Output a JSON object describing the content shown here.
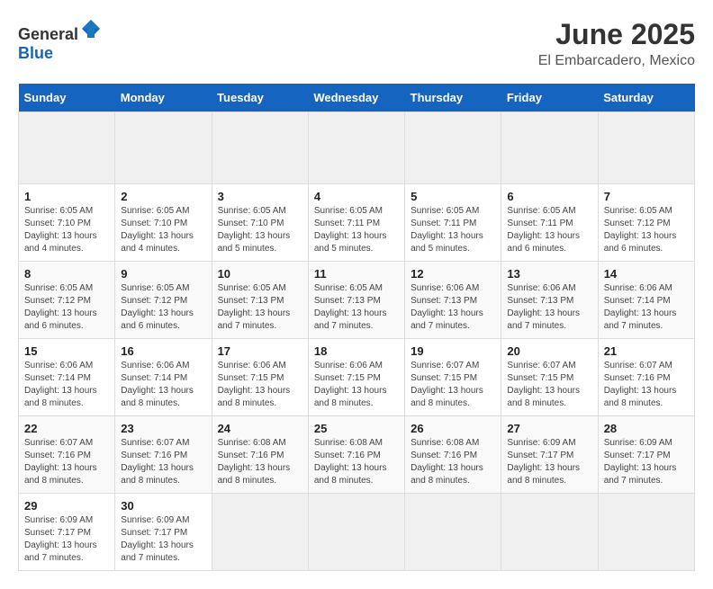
{
  "header": {
    "logo_general": "General",
    "logo_blue": "Blue",
    "title": "June 2025",
    "subtitle": "El Embarcadero, Mexico"
  },
  "calendar": {
    "days_of_week": [
      "Sunday",
      "Monday",
      "Tuesday",
      "Wednesday",
      "Thursday",
      "Friday",
      "Saturday"
    ],
    "weeks": [
      [
        {
          "day": "",
          "empty": true
        },
        {
          "day": "",
          "empty": true
        },
        {
          "day": "",
          "empty": true
        },
        {
          "day": "",
          "empty": true
        },
        {
          "day": "",
          "empty": true
        },
        {
          "day": "",
          "empty": true
        },
        {
          "day": "",
          "empty": true
        }
      ],
      [
        {
          "day": "1",
          "sunrise": "6:05 AM",
          "sunset": "7:10 PM",
          "daylight": "13 hours and 4 minutes."
        },
        {
          "day": "2",
          "sunrise": "6:05 AM",
          "sunset": "7:10 PM",
          "daylight": "13 hours and 4 minutes."
        },
        {
          "day": "3",
          "sunrise": "6:05 AM",
          "sunset": "7:10 PM",
          "daylight": "13 hours and 5 minutes."
        },
        {
          "day": "4",
          "sunrise": "6:05 AM",
          "sunset": "7:11 PM",
          "daylight": "13 hours and 5 minutes."
        },
        {
          "day": "5",
          "sunrise": "6:05 AM",
          "sunset": "7:11 PM",
          "daylight": "13 hours and 5 minutes."
        },
        {
          "day": "6",
          "sunrise": "6:05 AM",
          "sunset": "7:11 PM",
          "daylight": "13 hours and 6 minutes."
        },
        {
          "day": "7",
          "sunrise": "6:05 AM",
          "sunset": "7:12 PM",
          "daylight": "13 hours and 6 minutes."
        }
      ],
      [
        {
          "day": "8",
          "sunrise": "6:05 AM",
          "sunset": "7:12 PM",
          "daylight": "13 hours and 6 minutes."
        },
        {
          "day": "9",
          "sunrise": "6:05 AM",
          "sunset": "7:12 PM",
          "daylight": "13 hours and 6 minutes."
        },
        {
          "day": "10",
          "sunrise": "6:05 AM",
          "sunset": "7:13 PM",
          "daylight": "13 hours and 7 minutes."
        },
        {
          "day": "11",
          "sunrise": "6:05 AM",
          "sunset": "7:13 PM",
          "daylight": "13 hours and 7 minutes."
        },
        {
          "day": "12",
          "sunrise": "6:06 AM",
          "sunset": "7:13 PM",
          "daylight": "13 hours and 7 minutes."
        },
        {
          "day": "13",
          "sunrise": "6:06 AM",
          "sunset": "7:13 PM",
          "daylight": "13 hours and 7 minutes."
        },
        {
          "day": "14",
          "sunrise": "6:06 AM",
          "sunset": "7:14 PM",
          "daylight": "13 hours and 7 minutes."
        }
      ],
      [
        {
          "day": "15",
          "sunrise": "6:06 AM",
          "sunset": "7:14 PM",
          "daylight": "13 hours and 8 minutes."
        },
        {
          "day": "16",
          "sunrise": "6:06 AM",
          "sunset": "7:14 PM",
          "daylight": "13 hours and 8 minutes."
        },
        {
          "day": "17",
          "sunrise": "6:06 AM",
          "sunset": "7:15 PM",
          "daylight": "13 hours and 8 minutes."
        },
        {
          "day": "18",
          "sunrise": "6:06 AM",
          "sunset": "7:15 PM",
          "daylight": "13 hours and 8 minutes."
        },
        {
          "day": "19",
          "sunrise": "6:07 AM",
          "sunset": "7:15 PM",
          "daylight": "13 hours and 8 minutes."
        },
        {
          "day": "20",
          "sunrise": "6:07 AM",
          "sunset": "7:15 PM",
          "daylight": "13 hours and 8 minutes."
        },
        {
          "day": "21",
          "sunrise": "6:07 AM",
          "sunset": "7:16 PM",
          "daylight": "13 hours and 8 minutes."
        }
      ],
      [
        {
          "day": "22",
          "sunrise": "6:07 AM",
          "sunset": "7:16 PM",
          "daylight": "13 hours and 8 minutes."
        },
        {
          "day": "23",
          "sunrise": "6:07 AM",
          "sunset": "7:16 PM",
          "daylight": "13 hours and 8 minutes."
        },
        {
          "day": "24",
          "sunrise": "6:08 AM",
          "sunset": "7:16 PM",
          "daylight": "13 hours and 8 minutes."
        },
        {
          "day": "25",
          "sunrise": "6:08 AM",
          "sunset": "7:16 PM",
          "daylight": "13 hours and 8 minutes."
        },
        {
          "day": "26",
          "sunrise": "6:08 AM",
          "sunset": "7:16 PM",
          "daylight": "13 hours and 8 minutes."
        },
        {
          "day": "27",
          "sunrise": "6:09 AM",
          "sunset": "7:17 PM",
          "daylight": "13 hours and 8 minutes."
        },
        {
          "day": "28",
          "sunrise": "6:09 AM",
          "sunset": "7:17 PM",
          "daylight": "13 hours and 7 minutes."
        }
      ],
      [
        {
          "day": "29",
          "sunrise": "6:09 AM",
          "sunset": "7:17 PM",
          "daylight": "13 hours and 7 minutes."
        },
        {
          "day": "30",
          "sunrise": "6:09 AM",
          "sunset": "7:17 PM",
          "daylight": "13 hours and 7 minutes."
        },
        {
          "day": "",
          "empty": true
        },
        {
          "day": "",
          "empty": true
        },
        {
          "day": "",
          "empty": true
        },
        {
          "day": "",
          "empty": true
        },
        {
          "day": "",
          "empty": true
        }
      ]
    ]
  }
}
